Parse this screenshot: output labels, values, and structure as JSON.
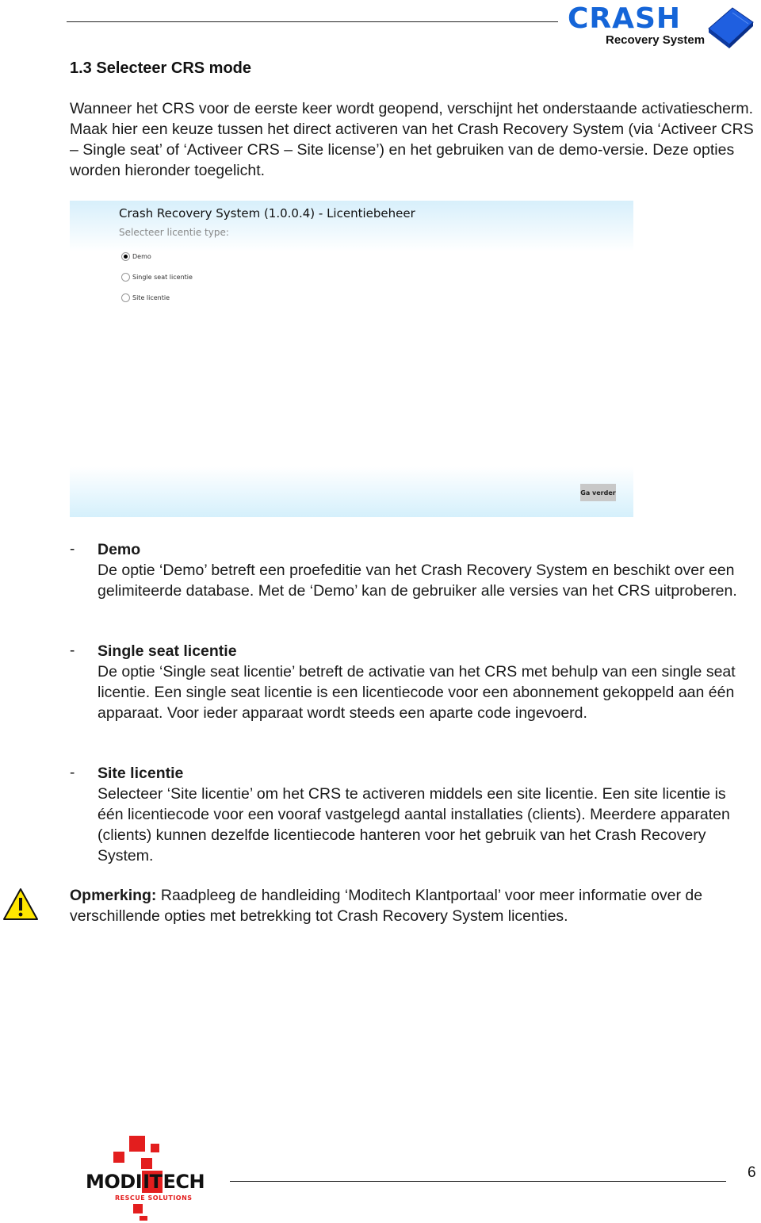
{
  "header": {
    "logo": {
      "name": "crash-recovery-system-logo",
      "word": "CRASH",
      "subtitle": "Recovery System",
      "brand_color": "#1565d8"
    }
  },
  "section": {
    "title": "1.3 Selecteer CRS mode",
    "intro": "Wanneer het CRS voor de eerste keer wordt geopend, verschijnt het onderstaande activatiescherm. Maak hier een keuze tussen het direct activeren van het Crash Recovery System (via ‘Activeer CRS – Single seat’ of ‘Activeer CRS – Site license’) en het gebruiken van de demo-versie. Deze opties worden hieronder toegelicht."
  },
  "screenshot": {
    "window_title": "Crash Recovery System (1.0.0.4) - Licentiebeheer",
    "subtitle": "Selecteer licentie type:",
    "radio_options": [
      {
        "label": "Demo",
        "checked": true
      },
      {
        "label": "Single seat licentie",
        "checked": false
      },
      {
        "label": "Site licentie",
        "checked": false
      }
    ],
    "continue_button": "Ga verder"
  },
  "options": [
    {
      "bullet": "-",
      "title": "Demo",
      "body": "De optie ‘Demo’ betreft een proefeditie van het Crash Recovery System en beschikt over een gelimiteerde database. Met de ‘Demo’ kan de gebruiker alle versies van het CRS uitproberen."
    },
    {
      "bullet": "-",
      "title": "Single seat licentie",
      "body": "De optie ‘Single seat licentie’ betreft de activatie van het CRS met behulp van een single seat licentie. Een single seat licentie is een licentiecode voor een abonnement gekoppeld aan één apparaat. Voor ieder apparaat wordt steeds een aparte code ingevoerd."
    },
    {
      "bullet": "-",
      "title": "Site licentie",
      "body": "Selecteer ‘Site licentie’ om het CRS te activeren middels een site licentie. Een site licentie is één licentiecode voor een vooraf vastgelegd aantal installaties (clients). Meerdere apparaten (clients) kunnen dezelfde licentiecode hanteren voor het gebruik van het Crash Recovery System."
    }
  ],
  "note": {
    "icon": "warning-icon",
    "label": "Opmerking:",
    "text": " Raadpleeg de handleiding ‘Moditech Klantportaal’ voor meer informatie over de verschillende opties met betrekking tot Crash Recovery System licenties."
  },
  "footer": {
    "logo": {
      "brand_prefix": "MODI",
      "brand_highlight": "IT",
      "brand_suffix": "ECH",
      "tagline": "RESCUE SOLUTIONS",
      "accent_color": "#e31e1e"
    },
    "page_number": "6"
  }
}
